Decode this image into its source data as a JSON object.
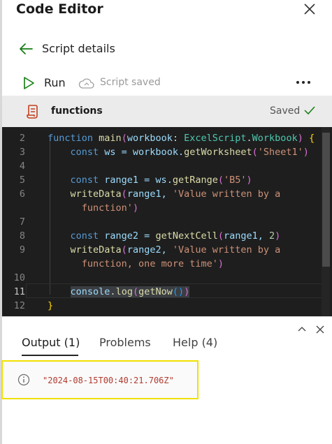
{
  "app": {
    "title": "Code Editor"
  },
  "nav": {
    "details_label": "Script details"
  },
  "toolbar": {
    "run_label": "Run",
    "status_label": "Script saved",
    "more_label": "•••"
  },
  "file": {
    "name": "functions",
    "saved_label": "Saved"
  },
  "editor": {
    "line_numbers": [
      "2",
      "3",
      "4",
      "5",
      "6",
      "",
      "7",
      "8",
      "9",
      "",
      "10",
      "11",
      "12"
    ],
    "active_line": "11",
    "lines": {
      "l2": {
        "kw": "function",
        "name": "main",
        "p1": "(",
        "arg": "workbook",
        "colon": ": ",
        "type": "ExcelScript",
        "dot": ".",
        "type2": "Workbook",
        "p2": ") ",
        "brace": "{"
      },
      "l3": {
        "kw": "const",
        "v": " ws = workbook.",
        "fn": "getWorksheet",
        "o": "(",
        "s": "'Sheet1'",
        "c": ")"
      },
      "l5": {
        "kw": "const",
        "v": " range1 = ws.",
        "fn": "getRange",
        "o": "(",
        "s": "'B5'",
        "c": ")"
      },
      "l6": {
        "fn": "writeData",
        "o": "(",
        "a": "range1, ",
        "s": "'Value written by a"
      },
      "l6b": {
        "s": "function'",
        "c": ")"
      },
      "l8": {
        "kw": "const",
        "v": " range2 = ",
        "fn": "getNextCell",
        "o": "(",
        "a": "range1, ",
        "n": "2",
        "c": ")"
      },
      "l9": {
        "fn": "writeData",
        "o": "(",
        "a": "range2, ",
        "s": "'Value written by a"
      },
      "l9b": {
        "s": "function, one more time'",
        "c": ")"
      },
      "l11": {
        "obj": "console",
        "dot": ".",
        "fn": "log",
        "o": "(",
        "fn2": "getNow",
        "o2": "()",
        "c": ")"
      },
      "l12": {
        "brace": "}"
      }
    }
  },
  "panel": {
    "tabs": [
      "Output (1)",
      "Problems",
      "Help (4)"
    ],
    "output_text": "\"2024-08-15T00:40:21.706Z\""
  },
  "icons": {
    "close": "close-icon",
    "back": "arrow-left-icon",
    "run": "play-icon",
    "cloud": "cloud-sync-icon",
    "more": "more-horizontal-icon",
    "file": "script-file-icon",
    "check": "checkmark-icon",
    "collapse": "chevron-up-icon",
    "panel_close": "close-icon",
    "info": "info-icon"
  },
  "colors": {
    "accent_green": "#107c10",
    "editor_bg": "#1e1e1e",
    "highlight_border": "#f0e000",
    "file_icon": "#c43e1c"
  }
}
